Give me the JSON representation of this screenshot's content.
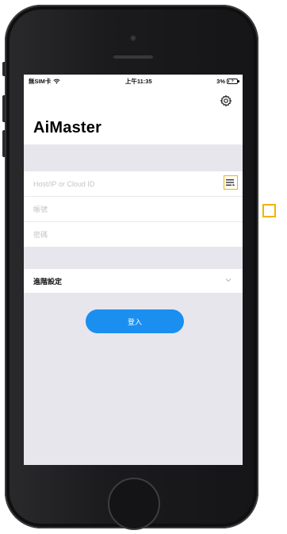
{
  "status_bar": {
    "carrier": "無SIM卡",
    "time": "上午11:35",
    "battery_percent": "3%"
  },
  "header": {
    "app_title": "AiMaster",
    "settings_icon": "gear-icon"
  },
  "login_form": {
    "host_placeholder": "Host/IP or Cloud ID",
    "account_placeholder": "帳號",
    "password_placeholder": "密碼",
    "list_icon": "list-icon",
    "highlight_color": "#f2b300"
  },
  "advanced_settings": {
    "label": "進階設定",
    "chevron_icon": "chevron-down-icon"
  },
  "login_button": {
    "label": "登入",
    "color": "#1a8ff0"
  }
}
